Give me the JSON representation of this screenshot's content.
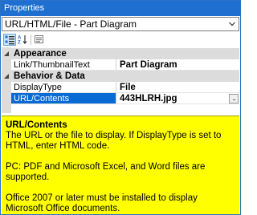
{
  "window": {
    "title": "Properties"
  },
  "object_selector": {
    "value": "URL/HTML/File - Part Diagram"
  },
  "toolbar": {
    "buttons": [
      {
        "name": "categorized-view",
        "icon": "categorized-icon",
        "active": true
      },
      {
        "name": "alphabetical-view",
        "icon": "sort-az-icon",
        "active": false
      },
      {
        "name": "property-pages",
        "icon": "property-pages-icon",
        "active": false
      }
    ]
  },
  "grid": {
    "categories": [
      {
        "label": "Appearance",
        "properties": [
          {
            "name": "Link/ThumbnailText",
            "value": "Part Diagram"
          }
        ]
      },
      {
        "label": "Behavior & Data",
        "properties": [
          {
            "name": "DisplayType",
            "value": "File"
          },
          {
            "name": "URL/Contents",
            "value": "443HLRH.jpg",
            "selected": true,
            "browse_label": "..."
          }
        ]
      }
    ]
  },
  "help": {
    "title": "URL/Contents",
    "paragraphs": [
      "The URL or the file to display. If DisplayType is set to HTML, enter HTML code.",
      "PC: PDF and Microsoft Excel, and Word files are supported.",
      "Office 2007 or later must be installed to display Microsoft Office documents."
    ]
  },
  "colors": {
    "titlebar": "#1f6fd0",
    "selection": "#0a6ad3",
    "help_background": "#ffff00",
    "category_background": "#dcdcdc"
  }
}
